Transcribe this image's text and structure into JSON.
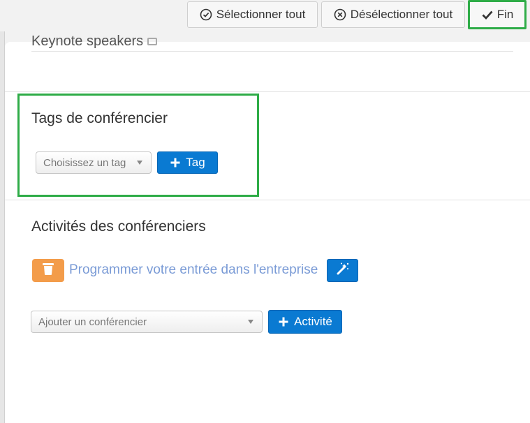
{
  "toolbar": {
    "select_all_label": "Sélectionner tout",
    "deselect_all_label": "Désélectionner tout",
    "done_label": "Fin"
  },
  "previous_section": {
    "partial_label": "Keynote speakers"
  },
  "speaker_tags": {
    "title": "Tags de conférencier",
    "select_placeholder": "Choisissez un tag",
    "add_button_label": "Tag"
  },
  "speaker_activities": {
    "title": "Activités des conférenciers",
    "activity_text": "Programmer votre entrée dans l'entreprise",
    "select_placeholder": "Ajouter un conférencier",
    "add_button_label": "Activité"
  },
  "colors": {
    "accent_blue": "#0a7ad2",
    "highlight_green": "#2eac47",
    "trash_orange": "#f39c4a",
    "link_blue": "#7a9bd6"
  },
  "icons": {
    "select_all": "check-circle-icon",
    "deselect_all": "x-circle-icon",
    "done": "checkmark-icon",
    "add": "plus-icon",
    "delete": "trash-icon",
    "auto": "magic-wand-icon"
  }
}
